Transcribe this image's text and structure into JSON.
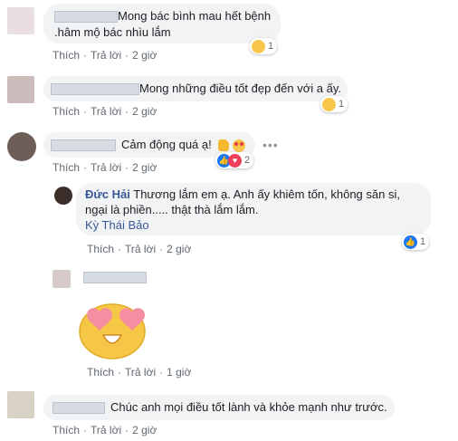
{
  "comments": [
    {
      "text_line1": "Mong bác bình mau hết bệnh",
      "text_line2": ".hâm mộ bác nhìu lắm",
      "reaction_count": "1",
      "actions": [
        "Thích",
        "Trả lời",
        "2 giờ"
      ]
    },
    {
      "text": "Mong những điều tốt đẹp đến với a ấy.",
      "reaction_count": "1",
      "actions": [
        "Thích",
        "Trả lời",
        "2 giờ"
      ]
    },
    {
      "text": "Cảm động quá ạ!",
      "reaction_count": "2",
      "actions": [
        "Thích",
        "Trả lời",
        "2 giờ"
      ]
    },
    {
      "author": "Đức Hải",
      "text_line1": "Thương lắm em ạ. Anh ấy khiêm tốn, không săn si,",
      "text_line2": "ngại là phiền..... thật thà lắm lắm.",
      "tag": "Kỳ Thái Bảo",
      "reaction_count": "1",
      "actions": [
        "Thích",
        "Trả lời",
        "2 giờ"
      ]
    },
    {
      "actions": [
        "Thích",
        "Trả lời",
        "1 giờ"
      ]
    },
    {
      "text": "Chúc anh mọi điều tốt lành và khỏe mạnh như trước.",
      "actions": [
        "Thích",
        "Trả lời",
        "2 giờ"
      ]
    }
  ],
  "more_glyph": "•••",
  "icons": {
    "haha": "haha-emoji",
    "like": "like-reaction",
    "love": "love-reaction",
    "thumb": "thumbs-up-emoji",
    "hearteyes": "heart-eyes-emoji"
  }
}
